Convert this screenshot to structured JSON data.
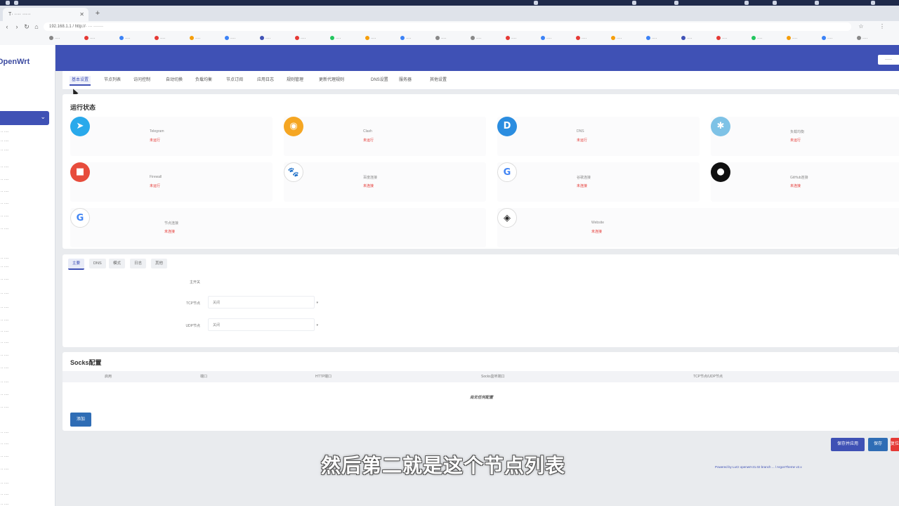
{
  "browser": {
    "tab_title": "T· ···· ·····",
    "url": "192.168.1.1 / http://· ··· ·······"
  },
  "sidebar": {
    "logo": "OpenWrt"
  },
  "header": {
    "button": "·····"
  },
  "tabs": [
    "基本设置",
    "节点列表",
    "访问控制",
    "自动切换",
    "负载均衡",
    "节点订阅",
    "应用日志",
    "规则管理",
    "更新代理规则",
    "DNS设置",
    "服务器",
    "其他设置"
  ],
  "status_card": {
    "title": "运行状态",
    "services": [
      {
        "name": "Telegram",
        "status": "未运行",
        "icon": "telegram-icon",
        "color": "#29a9eb",
        "glyph": "➤"
      },
      {
        "name": "Clash",
        "status": "未运行",
        "icon": "cat-icon",
        "color": "#f5a623",
        "glyph": "◉"
      },
      {
        "name": "DNS",
        "status": "未运行",
        "icon": "dns-icon",
        "color": "#2b8de0",
        "glyph": "D"
      },
      {
        "name": "负载均衡",
        "status": "未运行",
        "icon": "balance-icon",
        "color": "#7ec2e6",
        "glyph": "✱"
      },
      {
        "name": "Firewall",
        "status": "未运行",
        "icon": "firewall-icon",
        "color": "#e74c3c",
        "glyph": "■"
      },
      {
        "name": "百度连接",
        "status": "未连接",
        "icon": "baidu-icon",
        "color": "#ffffff",
        "glyph": "🐾"
      },
      {
        "name": "谷歌连接",
        "status": "未连接",
        "icon": "google-icon",
        "color": "#ffffff",
        "glyph": "G"
      },
      {
        "name": "GitHub连接",
        "status": "未连接",
        "icon": "github-icon",
        "color": "#111111",
        "glyph": "●"
      },
      {
        "name": "节点连接",
        "status": "未连接",
        "icon": "google-icon",
        "color": "#ffffff",
        "glyph": "G"
      },
      {
        "name": "Website",
        "status": "未连接",
        "icon": "shield-icon",
        "color": "#ffffff",
        "glyph": "◈"
      }
    ]
  },
  "form_card": {
    "subtabs": [
      "主要",
      "DNS",
      "模式",
      "日志",
      "其他"
    ],
    "fields": [
      {
        "label": "主开关",
        "value": ""
      },
      {
        "label": "TCP节点",
        "value": "关闭"
      },
      {
        "label": "UDP节点",
        "value": "关闭"
      }
    ]
  },
  "socks_card": {
    "title": "Socks配置",
    "headers": [
      "启用",
      "端口",
      "HTTP端口",
      "Socks监听端口",
      "TCP节点/UDP节点"
    ],
    "empty_text": "尚无任何配置",
    "add_button": "添加"
  },
  "actions": {
    "save_apply": "保存并应用",
    "save": "保存",
    "reset": "复位"
  },
  "footer_text": "Powered by LuCI openwrt-21.02 branch ... / ArgonTheme v2.x",
  "subtitle": "然后第二就是这个节点列表",
  "colors": {
    "accent": "#3f51b5",
    "danger": "#e53935",
    "primary_btn": "#2f6db5"
  }
}
